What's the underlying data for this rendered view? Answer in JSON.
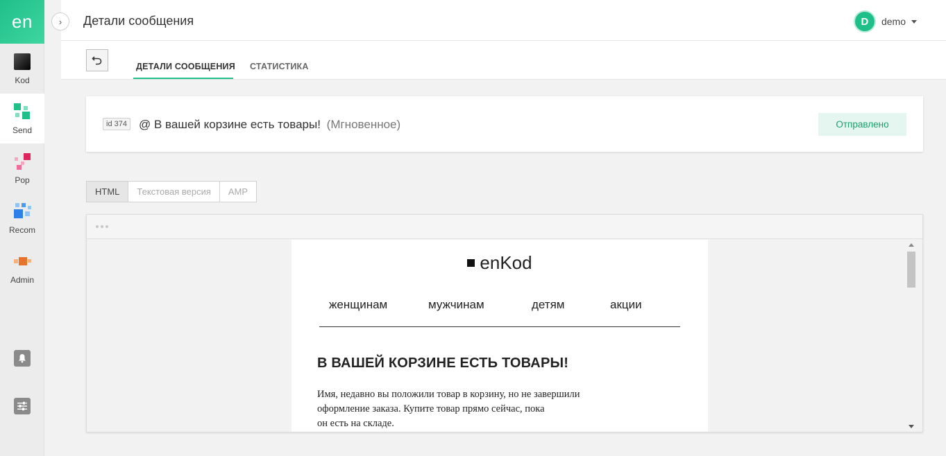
{
  "sidebar": {
    "logo": "en",
    "items": [
      {
        "label": "Kod",
        "icon": "kod-icon"
      },
      {
        "label": "Send",
        "icon": "send-icon"
      },
      {
        "label": "Pop",
        "icon": "pop-icon"
      },
      {
        "label": "Recom",
        "icon": "recom-icon"
      },
      {
        "label": "Admin",
        "icon": "admin-icon"
      }
    ],
    "bottom_icons": [
      "bell-icon",
      "settings-sliders-icon"
    ]
  },
  "header": {
    "title": "Детали сообщения",
    "user_initial": "D",
    "username": "demo"
  },
  "tabs": [
    {
      "label": "ДЕТАЛИ СООБЩЕНИЯ",
      "active": true
    },
    {
      "label": "СТАТИСТИКА",
      "active": false
    }
  ],
  "message": {
    "id_badge": "id 374",
    "subject": "@ В вашей корзине есть товары!",
    "type": "(Мгновенное)",
    "status": "Отправлено"
  },
  "view_switch": [
    "HTML",
    "Текстовая версия",
    "AMP"
  ],
  "email_preview": {
    "brand": "enKod",
    "nav": [
      "женщинам",
      "мужчинам",
      "детям",
      "акции"
    ],
    "headline": "В ВАШЕЙ КОРЗИНЕ ЕСТЬ ТОВАРЫ!",
    "body": "Имя, недавно вы положили товар в корзину, но не завершили\nоформление заказа. Купите товар прямо сейчас, пока\nон есть на складе."
  },
  "colors": {
    "accent": "#1fbf8a",
    "status_bg": "#e4f6ef",
    "status_text": "#1a9e6e"
  }
}
